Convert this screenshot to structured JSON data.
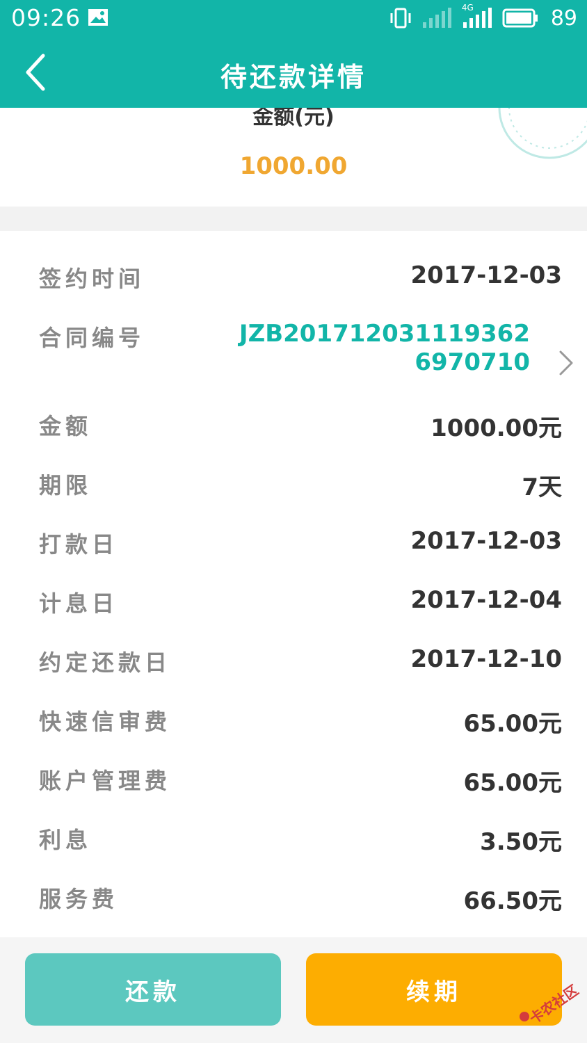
{
  "status_bar": {
    "time": "09:26",
    "network": "4G",
    "battery": "89",
    "icons": [
      "gallery-icon",
      "vibrate-icon",
      "signal-icon",
      "signal-4g-icon",
      "battery-icon"
    ]
  },
  "app_bar": {
    "title": "待还款详情",
    "back_icon": "chevron-left-icon"
  },
  "amount_card": {
    "label": "金额(元)",
    "value": "1000.00"
  },
  "details": {
    "sign_date": {
      "label": "签约时间",
      "value": "2017-12-03"
    },
    "contract_no": {
      "label": "合同编号",
      "value": "JZB2017120311193626970710"
    },
    "amount": {
      "label": "金额",
      "value": "1000.00元"
    },
    "term": {
      "label": "期限",
      "value": "7天"
    },
    "pay_date": {
      "label": "打款日",
      "value": "2017-12-03"
    },
    "interest_start": {
      "label": "计息日",
      "value": "2017-12-04"
    },
    "due_date": {
      "label": "约定还款日",
      "value": "2017-12-10"
    },
    "review_fee": {
      "label": "快速信审费",
      "value": "65.00元"
    },
    "account_fee": {
      "label": "账户管理费",
      "value": "65.00元"
    },
    "interest": {
      "label": "利息",
      "value": "3.50元"
    },
    "service_fee": {
      "label": "服务费",
      "value": "66.50元"
    }
  },
  "actions": {
    "repay": "还款",
    "renew": "续期"
  },
  "watermark": "卡农社区",
  "colors": {
    "primary": "#12b5a8",
    "amount": "#f0a731",
    "repay_button": "#5cc8bf",
    "renew_button": "#fdad01"
  }
}
